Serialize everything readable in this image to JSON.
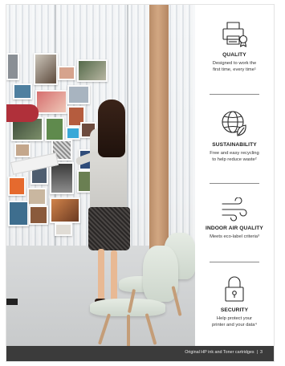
{
  "features": [
    {
      "title": "QUALITY",
      "desc_line1": "Designed to work the",
      "desc_line2": "first time, every time¹",
      "icon": "printer-quality-icon"
    },
    {
      "title": "SUSTAINABILITY",
      "desc_line1": "Free and easy recycling",
      "desc_line2": "to help reduce waste²",
      "icon": "globe-leaf-icon"
    },
    {
      "title": "INDOOR AIR QUALITY",
      "desc_line1": "Meets eco-label criteria³",
      "desc_line2": "",
      "icon": "air-waves-icon"
    },
    {
      "title": "SECURITY",
      "desc_line1": "Help protect your",
      "desc_line2": "printer and your data⁴",
      "icon": "padlock-icon"
    }
  ],
  "footer": {
    "label": "Original HP ink and Toner cartridges",
    "separator": "|",
    "page_number": "3"
  },
  "colors": {
    "footer_bar": "#3b3b3b",
    "text_dark": "#1b1b1b",
    "divider": "#8a8a8a"
  }
}
